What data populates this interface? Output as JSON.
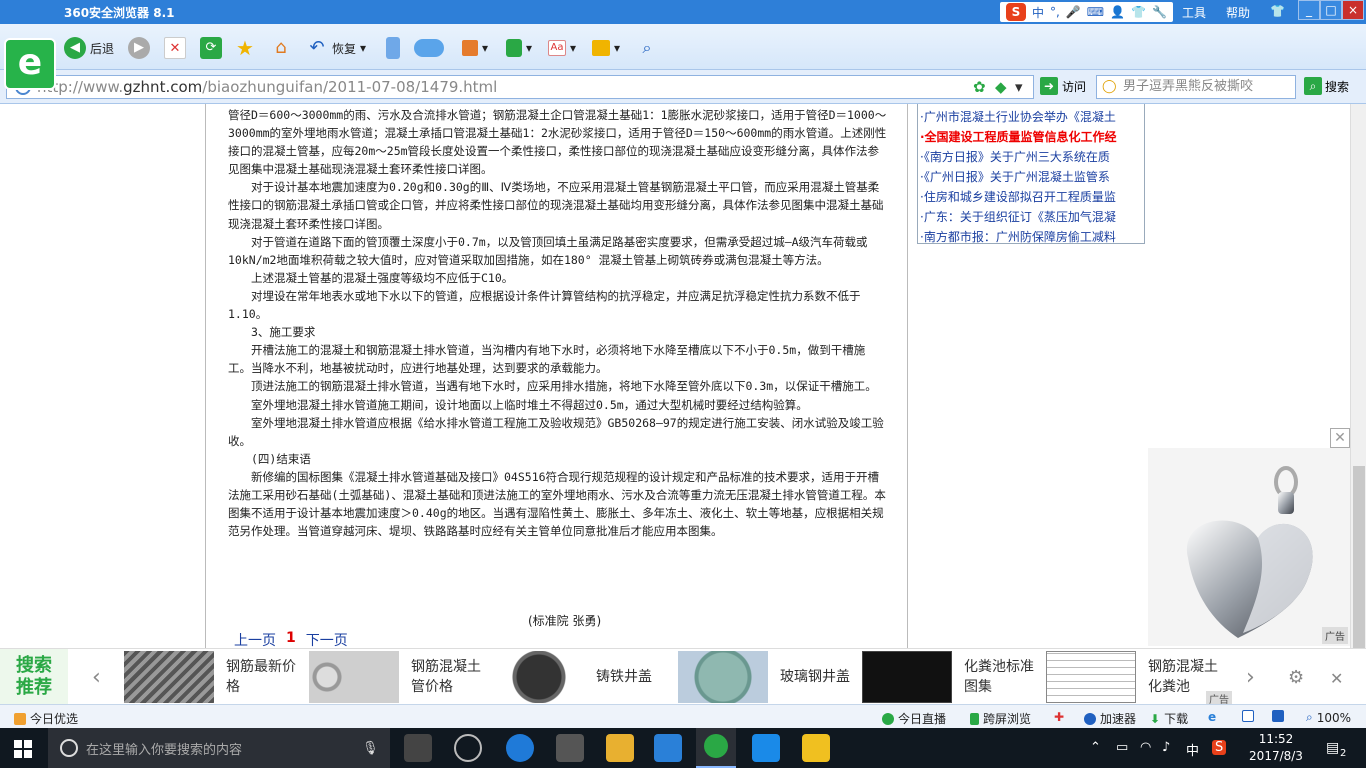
{
  "window": {
    "title": "360安全浏览器 8.1",
    "input_method": "中",
    "menu": [
      "工具",
      "帮助"
    ],
    "controls": [
      "_",
      "□",
      "×"
    ]
  },
  "toolbar": {
    "back_label": "后退",
    "restore_label": "恢复"
  },
  "address": {
    "url_prefix": "http://www.",
    "url_domain": "gzhnt.com",
    "url_path": "/biaozhunguifan/2011-07-08/1479.html",
    "go_label": "访问",
    "search_placeholder": "男子逗弄黑熊反被撕咬",
    "search_label": "搜索"
  },
  "article": {
    "paragraphs": [
      "管径D＝600～3000mm的雨、污水及合流排水管道；钢筋混凝土企口管混凝土基础1：1膨胀水泥砂浆接口，适用于管径D＝1000～3000mm的室外埋地雨水管道；混凝土承插口管混凝土基础1：2水泥砂浆接口，适用于管径D＝150～600mm的雨水管道。上述刚性接口的混凝土管基，应每20m～25m管段长度处设置一个柔性接口，柔性接口部位的现浇混凝土基础应设变形缝分离，具体作法参见图集中混凝土基础现浇混凝土套环柔性接口详图。",
      "　　对于设计基本地震加速度为0.20g和0.30g的Ⅲ、Ⅳ类场地，不应采用混凝土管基钢筋混凝土平口管，而应采用混凝土管基柔性接口的钢筋混凝土承插口管或企口管，并应将柔性接口部位的现浇混凝土基础均用变形缝分离，具体作法参见图集中混凝土基础现浇混凝土套环柔性接口详图。",
      "　　对于管道在道路下面的管顶覆土深度小于0.7m，以及管顶回填土虽满足路基密实度要求，但需承受超过城—A级汽车荷载或10kN/m2地面堆积荷载之较大值时，应对管道采取加固措施，如在180° 混凝土管基上砌筑砖券或满包混凝土等方法。",
      "　　上述混凝土管基的混凝土强度等级均不应低于C10。",
      "　　对埋设在常年地表水或地下水以下的管道，应根据设计条件计算管结构的抗浮稳定，并应满足抗浮稳定性抗力系数不低于1.10。",
      "　　3、施工要求",
      "　　开槽法施工的混凝土和钢筋混凝土排水管道，当沟槽内有地下水时，必须将地下水降至槽底以下不小于0.5m，做到干槽施工。当降水不利，地基被扰动时，应进行地基处理，达到要求的承载能力。",
      "　　顶进法施工的钢筋混凝土排水管道，当遇有地下水时，应采用排水措施，将地下水降至管外底以下0.3m，以保证干槽施工。",
      "　　室外埋地混凝土排水管道施工期间，设计地面以上临时堆土不得超过0.5m，通过大型机械时要经过结构验算。",
      "　　室外埋地混凝土排水管道应根据《给水排水管道工程施工及验收规范》GB50268—97的规定进行施工安装、闭水试验及竣工验收。",
      "　　(四)结束语",
      "　　新修编的国标图集《混凝土排水管道基础及接口》04S516符合现行规范规程的设计规定和产品标准的技术要求，适用于开槽法施工采用砂石基础(土弧基础)、混凝土基础和顶进法施工的室外埋地雨水、污水及合流等重力流无压混凝土排水管管道工程。本图集不适用于设计基本地震加速度＞0.40g的地区。当遇有湿陷性黄土、膨胀土、多年冻土、液化土、软土等地基，应根据相关规范另作处理。当管道穿越河床、堤坝、铁路路基时应经有关主管单位同意批准后才能应用本图集。"
    ],
    "signature": "(标准院 张勇)",
    "prev": "上一页",
    "page": "1",
    "next": "下一页"
  },
  "side_news": [
    "·广州市混凝土行业协会举办《混凝土",
    "·全国建设工程质量监管信息化工作经",
    "·《南方日报》关于广州三大系统在质",
    "·《广州日报》关于广州混凝土监管系",
    "·住房和城乡建设部拟召开工程质量监",
    "·广东：关于组织征订《蒸压加气混凝",
    "·南方都市报：广州防保障房偷工减料"
  ],
  "ad": {
    "label": "广告"
  },
  "recommend": {
    "title_line1": "搜索",
    "title_line2": "推荐",
    "items": [
      "钢筋最新价格",
      "钢筋混凝土管价格",
      "铸铁井盖",
      "玻璃钢井盖",
      "化粪池标准图集",
      "钢筋混凝土化粪池"
    ],
    "ad_label": "广告"
  },
  "status": {
    "left": "今日优选",
    "live": "今日直播",
    "cross": "跨屏浏览",
    "accel": "加速器",
    "download": "下载",
    "zoom": "100%"
  },
  "taskbar": {
    "search_placeholder": "在这里输入你要搜索的内容",
    "ime": "中",
    "time": "11:52",
    "date": "2017/8/3",
    "notify_count": "2"
  },
  "colors": {
    "titlebar": "#2e7fd8",
    "brand_green": "#27b34a",
    "link": "#1a3fa0",
    "hot": "#e00000"
  }
}
